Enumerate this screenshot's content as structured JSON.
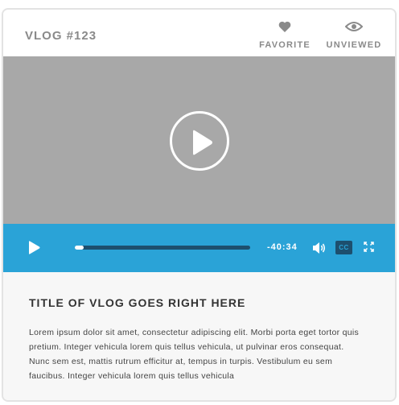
{
  "header": {
    "vlog_label": "VLOG #123",
    "favorite_label": "FAVORITE",
    "unviewed_label": "UNVIEWED"
  },
  "player": {
    "progress": 0.05,
    "time_remaining": "-40:34",
    "cc_label": "CC"
  },
  "content": {
    "title": "TITLE OF VLOG GOES RIGHT HERE",
    "description": "Lorem ipsum dolor sit amet, consectetur adipiscing elit. Morbi porta eget tortor quis pretium. Integer vehicula lorem quis tellus vehicula, ut pulvinar eros consequat. Nunc sem est, mattis rutrum efficitur at, tempus in turpis. Vestibulum eu sem faucibus. Integer vehicula lorem quis tellus vehicula"
  },
  "colors": {
    "accent": "#2aa3d7",
    "accent_dark": "#1d4f6e",
    "video_bg": "#a8a8a8",
    "icon_gray": "#8a8a8a"
  },
  "icons": [
    "heart-icon",
    "eye-icon",
    "play-icon",
    "volume-icon",
    "cc-icon",
    "fullscreen-icon"
  ]
}
